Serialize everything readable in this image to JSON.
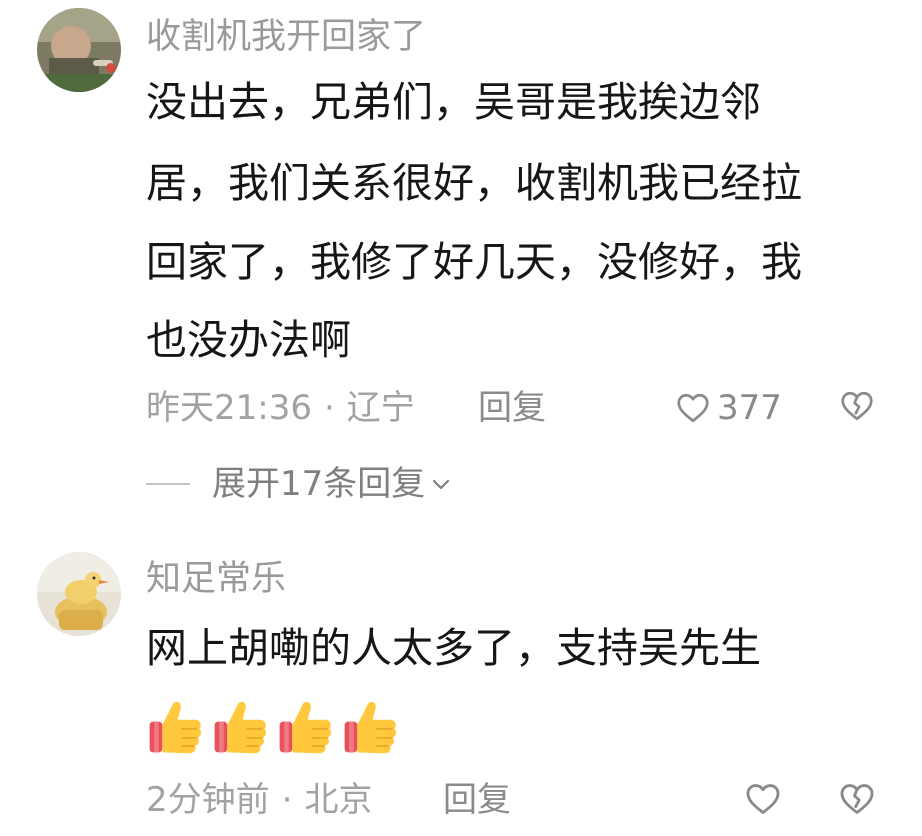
{
  "comments": [
    {
      "username": "收割机我开回家了",
      "lines": [
        "没出去，兄弟们，吴哥是我挨边邻",
        "居，我们关系很好，收割机我已经拉",
        "回家了，我修了好几天，没修好，我",
        "也没办法啊"
      ],
      "time": "昨天21:36",
      "separator": "·",
      "location": "辽宁",
      "reply_label": "回复",
      "like_count": "377",
      "expand_label": "展开17条回复",
      "expand_chevron": "chevron-down-icon"
    },
    {
      "username": "知足常乐",
      "lines": [
        "网上胡嘞的人太多了，支持吴先生"
      ],
      "emojis": [
        "thumbs-up",
        "thumbs-up",
        "thumbs-up",
        "thumbs-up"
      ],
      "time": "2分钟前",
      "separator": "·",
      "location": "北京",
      "reply_label": "回复"
    }
  ],
  "colors": {
    "username": "#9a9a9a",
    "body": "#161616",
    "meta": "#a2a2a2",
    "icon": "#8a8a8a"
  }
}
